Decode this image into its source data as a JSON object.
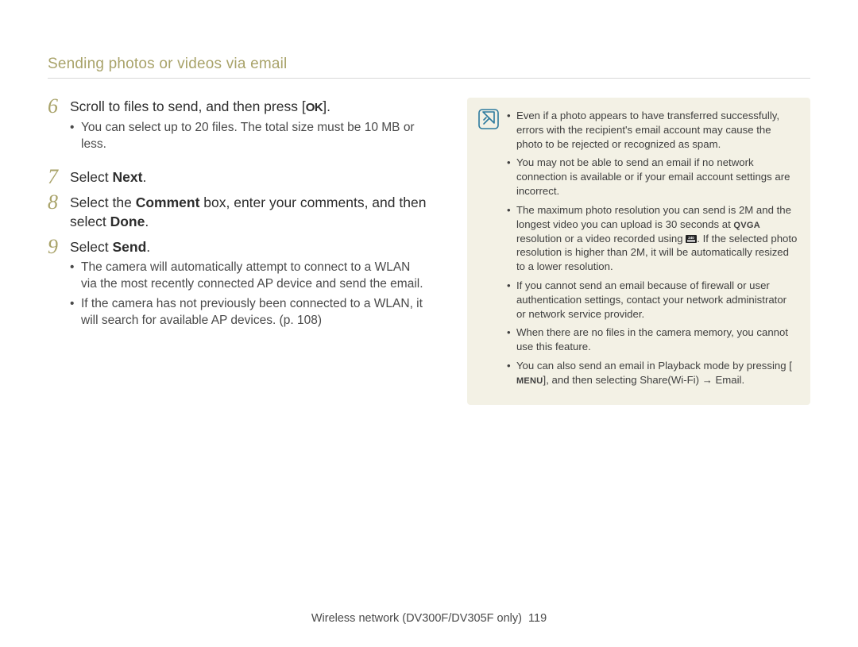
{
  "header": {
    "title": "Sending photos or videos via email"
  },
  "steps": {
    "s6": {
      "num": "6",
      "text_before": "Scroll to files to send, and then press [",
      "ok": "OK",
      "text_after": "].",
      "sub": [
        "You can select up to 20 files. The total size must be 10 MB or less."
      ]
    },
    "s7": {
      "num": "7",
      "prefix": "Select ",
      "bold": "Next",
      "suffix": "."
    },
    "s8": {
      "num": "8",
      "prefix": "Select the ",
      "bold1": "Comment",
      "mid": " box, enter your comments, and then select ",
      "bold2": "Done",
      "suffix": "."
    },
    "s9": {
      "num": "9",
      "prefix": "Select ",
      "bold": "Send",
      "suffix": ".",
      "sub": [
        "The camera will automatically attempt to connect to a WLAN via the most recently connected AP device and send the email.",
        "If the camera has not previously been connected to a WLAN, it will search for available AP devices. (p. 108)"
      ]
    }
  },
  "notes": {
    "n1": "Even if a photo appears to have transferred successfully, errors with the recipient's email account may cause the photo to be rejected or recognized as spam.",
    "n2": "You may not be able to send an email if no network connection is available or if your email account settings are incorrect.",
    "n3_a": "The maximum photo resolution you can send is 2M and the longest video you can upload is 30 seconds at ",
    "n3_qvga": "QVGA",
    "n3_b": " resolution or a video recorded using ",
    "n3_c": ". If the selected photo resolution is higher than 2M, it will be automatically resized to a lower resolution.",
    "n4": "If you cannot send an email because of firewall or user authentication settings, contact your network administrator or network service provider.",
    "n5": "When there are no files in the camera memory, you cannot use this feature.",
    "n6_a": "You can also send an email in Playback mode by pressing [",
    "n6_menu": "MENU",
    "n6_b": "], and then selecting ",
    "n6_bold": "Share(Wi-Fi) → Email",
    "n6_c": "."
  },
  "footer": {
    "section": "Wireless network (DV300F/DV305F only)",
    "page": "119"
  }
}
